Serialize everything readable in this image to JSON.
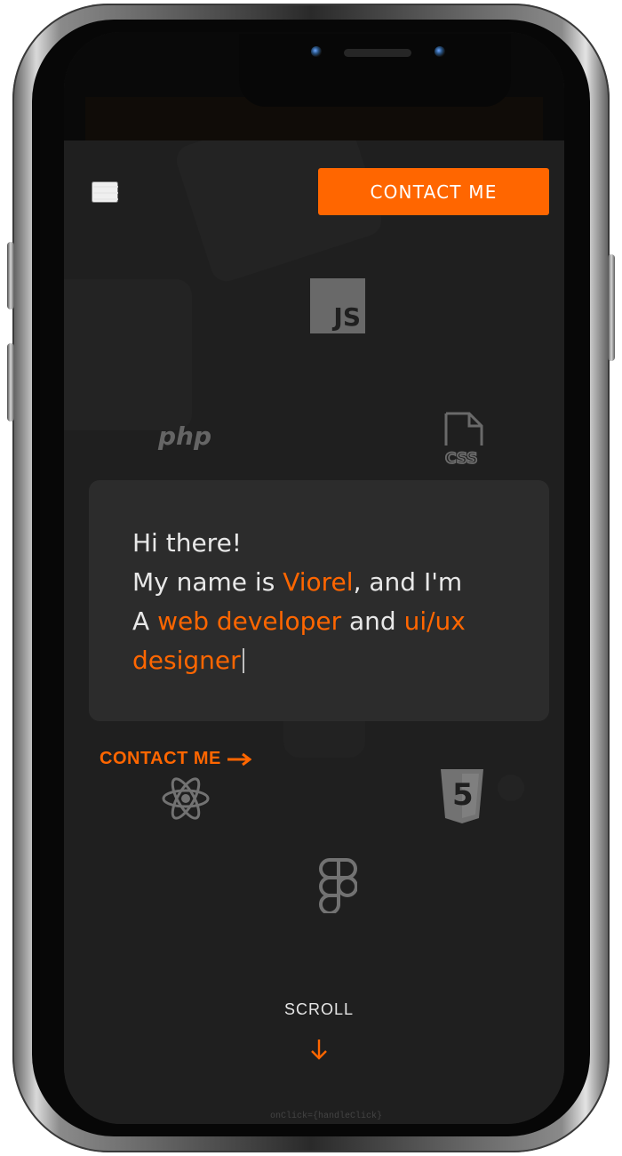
{
  "header": {
    "menu_icon": "hamburger-menu-icon",
    "contact_button": "CONTACT ME"
  },
  "hero": {
    "line1": "Hi there!",
    "line2_prefix": "My name is ",
    "name": "Viorel",
    "line2_suffix": ", and I'm",
    "line3_prefix": "A ",
    "role_primary": "web developer",
    "line3_mid": " and ",
    "role_secondary_start": "ui/ux",
    "role_secondary_end": "designer"
  },
  "cta": {
    "contact_link": "CONTACT ME",
    "icon": "arrow-right-icon"
  },
  "technology_icons": {
    "js_text": "JS",
    "php_text": "php",
    "css_text": "CSS",
    "html_number": "5",
    "icons": [
      "javascript-icon",
      "php-icon",
      "css-file-icon",
      "react-icon",
      "html5-icon",
      "figma-icon"
    ]
  },
  "footer": {
    "scroll_label": "SCROLL",
    "scroll_icon": "arrow-down-icon",
    "faint_code": "onClick={handleClick}"
  },
  "colors": {
    "accent": "#ff6600",
    "background": "#1f1f1f",
    "card": "#2d2d2d",
    "text": "#e8e8e8",
    "muted_icon": "#6e6e6e"
  }
}
